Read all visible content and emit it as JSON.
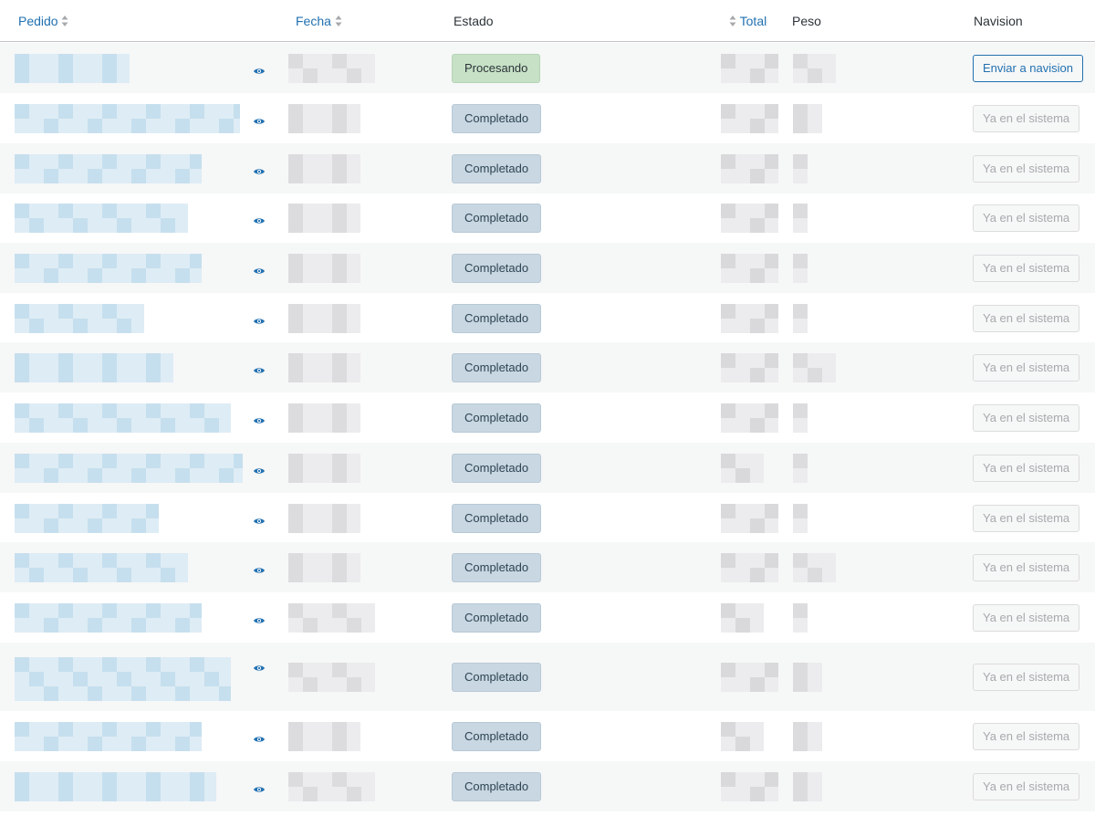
{
  "header": {
    "col_order": "Pedido",
    "col_date": "Fecha",
    "col_status": "Estado",
    "col_total": "Total",
    "col_weight": "Peso",
    "col_navision": "Navision"
  },
  "icons": {
    "sort": "sort-arrows-icon",
    "view": "eye-icon"
  },
  "colors": {
    "link": "#2271b1",
    "processing_bg": "#c6e1c6",
    "completed_bg": "#c8d7e1",
    "row_alt": "#f6f7f7",
    "redacted_blue": "#cfe3ef",
    "redacted_gray": "#e3e3e5"
  },
  "rows": [
    {
      "status": "Procesando",
      "navision": "Enviar a navision",
      "navision_enabled": true
    },
    {
      "status": "Completado",
      "navision": "Ya en el sistema",
      "navision_enabled": false
    },
    {
      "status": "Completado",
      "navision": "Ya en el sistema",
      "navision_enabled": false
    },
    {
      "status": "Completado",
      "navision": "Ya en el sistema",
      "navision_enabled": false
    },
    {
      "status": "Completado",
      "navision": "Ya en el sistema",
      "navision_enabled": false
    },
    {
      "status": "Completado",
      "navision": "Ya en el sistema",
      "navision_enabled": false
    },
    {
      "status": "Completado",
      "navision": "Ya en el sistema",
      "navision_enabled": false
    },
    {
      "status": "Completado",
      "navision": "Ya en el sistema",
      "navision_enabled": false
    },
    {
      "status": "Completado",
      "navision": "Ya en el sistema",
      "navision_enabled": false
    },
    {
      "status": "Completado",
      "navision": "Ya en el sistema",
      "navision_enabled": false
    },
    {
      "status": "Completado",
      "navision": "Ya en el sistema",
      "navision_enabled": false
    },
    {
      "status": "Completado",
      "navision": "Ya en el sistema",
      "navision_enabled": false
    },
    {
      "status": "Completado",
      "navision": "Ya en el sistema",
      "navision_enabled": false
    },
    {
      "status": "Completado",
      "navision": "Ya en el sistema",
      "navision_enabled": false
    },
    {
      "status": "Completado",
      "navision": "Ya en el sistema",
      "navision_enabled": false
    }
  ]
}
